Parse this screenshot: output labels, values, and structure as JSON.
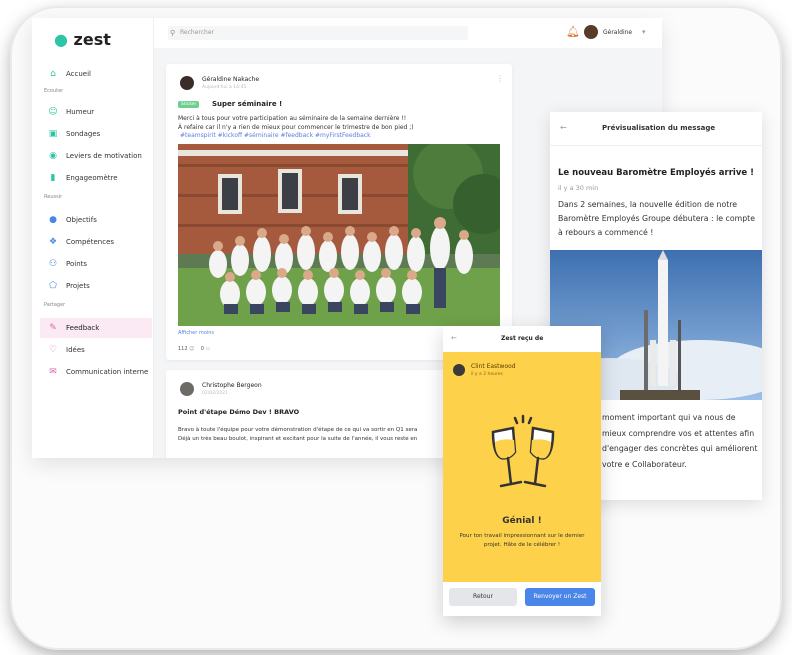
{
  "brand": {
    "logo": "zest"
  },
  "sidebar": {
    "items": [
      {
        "label": "Accueil",
        "icon": "home-icon"
      },
      {
        "label": "Humeur",
        "icon": "smile-icon"
      },
      {
        "label": "Sondages",
        "icon": "survey-icon"
      },
      {
        "label": "Leviers de motivation",
        "icon": "lever-icon"
      },
      {
        "label": "Engageomètre",
        "icon": "bars-icon"
      },
      {
        "label": "Objectifs",
        "icon": "target-icon"
      },
      {
        "label": "Compétences",
        "icon": "puzzle-icon"
      },
      {
        "label": "Points",
        "icon": "people-icon"
      },
      {
        "label": "Projets",
        "icon": "project-icon"
      },
      {
        "label": "Feedback",
        "icon": "pencil-icon"
      },
      {
        "label": "Idées",
        "icon": "bulb-icon"
      },
      {
        "label": "Communication interne",
        "icon": "mail-icon"
      }
    ],
    "sections": [
      "Ecouter",
      "Reussir",
      "Partager"
    ]
  },
  "header": {
    "search_placeholder": "Rechercher",
    "user_name": "Géraldine"
  },
  "feed": {
    "post1": {
      "author": "Géraldine Nakache",
      "date": "Aujourd'hui à 14:45",
      "tag": "Sticker",
      "title": "Super séminaire !",
      "line1": "Merci à tous pour votre participation au séminaire de la semaine dernière !!",
      "line2": "À refaire car il n'y a rien de mieux pour commencer le trimestre de bon pied ;)",
      "hashtags": "#teamspirit #kickoff #séminaire #feedback #myFirstFeedback",
      "more": "Afficher moins",
      "likes": "112",
      "comments": "0"
    },
    "post2": {
      "author": "Christophe Bergeon",
      "date": "02/02/2021",
      "title": "Point d'étape Démo Dev ! BRAVO",
      "line1": "Bravo à toute l'équipe pour votre démonstration d'étape de ce qui va sortir en Q1 sera",
      "line2": "Déjà un très beau boulot, inspirant et excitant pour la suite de l'année, il vous reste en"
    }
  },
  "preview": {
    "header": "Prévisualisation du message",
    "title": "Le nouveau Baromètre Employés arrive !",
    "time": "il y a 30 min",
    "body": "Dans 2 semaines, la nouvelle édition de notre Baromètre Employés Groupe débutera : le compte à rebours a commencé !",
    "body2": "moment important qui va nous de mieux comprendre vos et attentes afin d'engager des concrètes qui améliorent votre e Collaborateur."
  },
  "zest": {
    "header": "Zest reçu de",
    "sender": "Clint Eastwood",
    "time": "il y a 2 heures",
    "great": "Génial !",
    "message": "Pour ton travail impressionnant sur le dernier projet. Hâte de le célébrer !",
    "back_button": "Retour",
    "send_button": "Renvoyer un Zest"
  }
}
